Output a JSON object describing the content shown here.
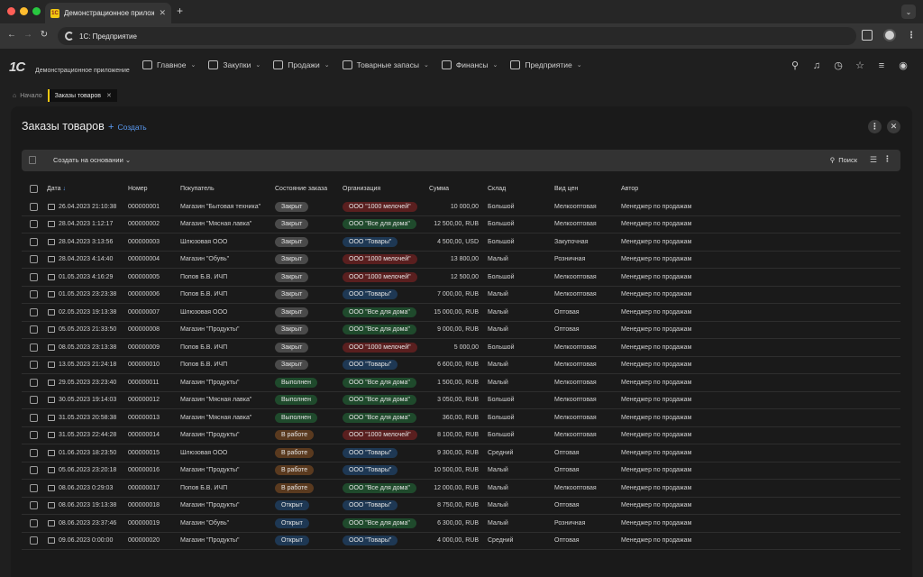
{
  "browser": {
    "tab_title": "Демонстрационное прилож",
    "favicon_text": "1С",
    "url": "1С: Предприятие"
  },
  "app": {
    "logo": "1С",
    "name": "Демонстрационное приложение",
    "menu": [
      {
        "label": "Главное",
        "icon": "grid-icon"
      },
      {
        "label": "Закупки",
        "icon": "cart-icon"
      },
      {
        "label": "Продажи",
        "icon": "bag-icon"
      },
      {
        "label": "Товарные запасы",
        "icon": "warehouse-icon"
      },
      {
        "label": "Финансы",
        "icon": "wallet-icon"
      },
      {
        "label": "Предприятие",
        "icon": "factory-icon"
      }
    ]
  },
  "breadcrumbs": {
    "home": "Начало",
    "active": "Заказы товаров"
  },
  "panel": {
    "title": "Заказы товаров",
    "create_label": "Создать",
    "based_on_label": "Создать на основании",
    "search_label": "Поиск"
  },
  "table": {
    "headers": {
      "date": "Дата",
      "number": "Номер",
      "buyer": "Покупатель",
      "state": "Состояние заказа",
      "org": "Организация",
      "sum": "Сумма",
      "warehouse": "Склад",
      "price_type": "Вид цен",
      "author": "Автор"
    },
    "rows": [
      {
        "date": "26.04.2023 21:10:38",
        "number": "000000001",
        "buyer": "Магазин \"Бытовая техника\"",
        "state": "Закрыт",
        "org": "ООО \"1000 мелочей\"",
        "sum": "10 000,00",
        "warehouse": "Большой",
        "price_type": "Мелкооптовая",
        "author": "Менеджер по продажам"
      },
      {
        "date": "28.04.2023 1:12:17",
        "number": "000000002",
        "buyer": "Магазин \"Мясная лавка\"",
        "state": "Закрыт",
        "org": "ООО \"Все для дома\"",
        "sum": "12 500,00, RUB",
        "warehouse": "Большой",
        "price_type": "Мелкооптовая",
        "author": "Менеджер по продажам"
      },
      {
        "date": "28.04.2023 3:13:56",
        "number": "000000003",
        "buyer": "Шлюзовая ООО",
        "state": "Закрыт",
        "org": "ООО \"Товары\"",
        "sum": "4 500,00, USD",
        "warehouse": "Большой",
        "price_type": "Закупочная",
        "author": "Менеджер по продажам"
      },
      {
        "date": "28.04.2023 4:14:40",
        "number": "000000004",
        "buyer": "Магазин \"Обувь\"",
        "state": "Закрыт",
        "org": "ООО \"1000 мелочей\"",
        "sum": "13 800,00",
        "warehouse": "Малый",
        "price_type": "Розничная",
        "author": "Менеджер по продажам"
      },
      {
        "date": "01.05.2023 4:16:29",
        "number": "000000005",
        "buyer": "Попов Б.В. ИЧП",
        "state": "Закрыт",
        "org": "ООО \"1000 мелочей\"",
        "sum": "12 500,00",
        "warehouse": "Большой",
        "price_type": "Мелкооптовая",
        "author": "Менеджер по продажам"
      },
      {
        "date": "01.05.2023 23:23:38",
        "number": "000000006",
        "buyer": "Попов Б.В. ИЧП",
        "state": "Закрыт",
        "org": "ООО \"Товары\"",
        "sum": "7 000,00, RUB",
        "warehouse": "Малый",
        "price_type": "Мелкооптовая",
        "author": "Менеджер по продажам"
      },
      {
        "date": "02.05.2023 19:13:38",
        "number": "000000007",
        "buyer": "Шлюзовая ООО",
        "state": "Закрыт",
        "org": "ООО \"Все для дома\"",
        "sum": "15 000,00, RUB",
        "warehouse": "Малый",
        "price_type": "Оптовая",
        "author": "Менеджер по продажам"
      },
      {
        "date": "05.05.2023 21:33:50",
        "number": "000000008",
        "buyer": "Магазин \"Продукты\"",
        "state": "Закрыт",
        "org": "ООО \"Все для дома\"",
        "sum": "9 000,00, RUB",
        "warehouse": "Малый",
        "price_type": "Оптовая",
        "author": "Менеджер по продажам"
      },
      {
        "date": "08.05.2023 23:13:38",
        "number": "000000009",
        "buyer": "Попов Б.В. ИЧП",
        "state": "Закрыт",
        "org": "ООО \"1000 мелочей\"",
        "sum": "5 000,00",
        "warehouse": "Большой",
        "price_type": "Мелкооптовая",
        "author": "Менеджер по продажам"
      },
      {
        "date": "13.05.2023 21:24:18",
        "number": "000000010",
        "buyer": "Попов Б.В. ИЧП",
        "state": "Закрыт",
        "org": "ООО \"Товары\"",
        "sum": "6 600,00, RUB",
        "warehouse": "Малый",
        "price_type": "Мелкооптовая",
        "author": "Менеджер по продажам"
      },
      {
        "date": "29.05.2023 23:23:40",
        "number": "000000011",
        "buyer": "Магазин \"Продукты\"",
        "state": "Выполнен",
        "org": "ООО \"Все для дома\"",
        "sum": "1 500,00, RUB",
        "warehouse": "Малый",
        "price_type": "Мелкооптовая",
        "author": "Менеджер по продажам"
      },
      {
        "date": "30.05.2023 19:14:03",
        "number": "000000012",
        "buyer": "Магазин \"Мясная лавка\"",
        "state": "Выполнен",
        "org": "ООО \"Все для дома\"",
        "sum": "3 050,00, RUB",
        "warehouse": "Большой",
        "price_type": "Мелкооптовая",
        "author": "Менеджер по продажам"
      },
      {
        "date": "31.05.2023 20:58:38",
        "number": "000000013",
        "buyer": "Магазин \"Мясная лавка\"",
        "state": "Выполнен",
        "org": "ООО \"Все для дома\"",
        "sum": "360,00, RUB",
        "warehouse": "Большой",
        "price_type": "Мелкооптовая",
        "author": "Менеджер по продажам"
      },
      {
        "date": "31.05.2023 22:44:28",
        "number": "000000014",
        "buyer": "Магазин \"Продукты\"",
        "state": "В работе",
        "org": "ООО \"1000 мелочей\"",
        "sum": "8 100,00, RUB",
        "warehouse": "Большой",
        "price_type": "Мелкооптовая",
        "author": "Менеджер по продажам"
      },
      {
        "date": "01.06.2023 18:23:50",
        "number": "000000015",
        "buyer": "Шлюзовая ООО",
        "state": "В работе",
        "org": "ООО \"Товары\"",
        "sum": "9 300,00, RUB",
        "warehouse": "Средний",
        "price_type": "Оптовая",
        "author": "Менеджер по продажам"
      },
      {
        "date": "05.06.2023 23:20:18",
        "number": "000000016",
        "buyer": "Магазин \"Продукты\"",
        "state": "В работе",
        "org": "ООО \"Товары\"",
        "sum": "10 500,00, RUB",
        "warehouse": "Малый",
        "price_type": "Оптовая",
        "author": "Менеджер по продажам"
      },
      {
        "date": "08.06.2023 0:29:03",
        "number": "000000017",
        "buyer": "Попов Б.В. ИЧП",
        "state": "В работе",
        "org": "ООО \"Все для дома\"",
        "sum": "12 000,00, RUB",
        "warehouse": "Малый",
        "price_type": "Мелкооптовая",
        "author": "Менеджер по продажам"
      },
      {
        "date": "08.06.2023 19:13:38",
        "number": "000000018",
        "buyer": "Магазин \"Продукты\"",
        "state": "Открыт",
        "org": "ООО \"Товары\"",
        "sum": "8 750,00, RUB",
        "warehouse": "Малый",
        "price_type": "Оптовая",
        "author": "Менеджер по продажам"
      },
      {
        "date": "08.06.2023 23:37:46",
        "number": "000000019",
        "buyer": "Магазин \"Обувь\"",
        "state": "Открыт",
        "org": "ООО \"Все для дома\"",
        "sum": "6 300,00, RUB",
        "warehouse": "Малый",
        "price_type": "Розничная",
        "author": "Менеджер по продажам"
      },
      {
        "date": "09.06.2023 0:00:00",
        "number": "000000020",
        "buyer": "Магазин \"Продукты\"",
        "state": "Открыт",
        "org": "ООО \"Товары\"",
        "sum": "4 000,00, RUB",
        "warehouse": "Средний",
        "price_type": "Оптовая",
        "author": "Менеджер по продажам"
      }
    ]
  },
  "colors": {
    "accent": "#5b9bf3",
    "brand": "#f2c811",
    "state_closed": "#4a4a4a",
    "state_done": "#1f4a2c",
    "state_work": "#5a3a1f",
    "state_open": "#1e3854",
    "org_1000": "#5a1f1f",
    "org_home": "#1f4a2c",
    "org_goods": "#1e3854"
  }
}
